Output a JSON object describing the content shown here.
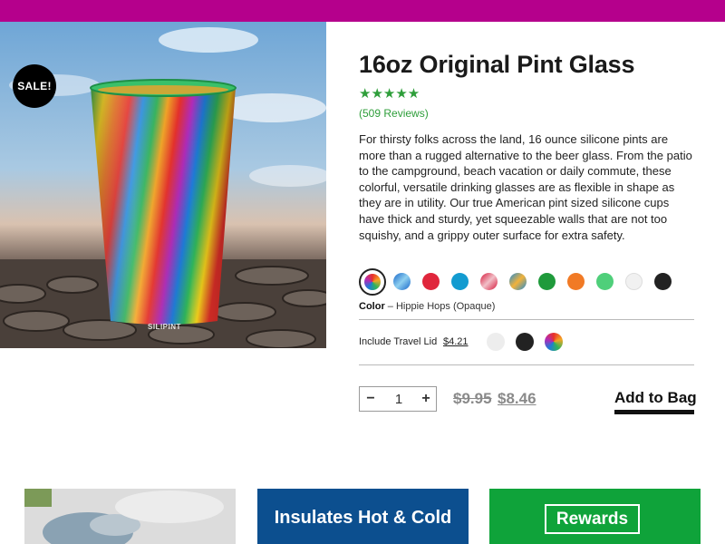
{
  "colors": {
    "top_bar": "#b5008c",
    "star_green": "#2e9e3a",
    "tile_blue": "#0c4f8f",
    "tile_green": "#0fa33a"
  },
  "product": {
    "sale_badge": "SALE!",
    "image_logo": "SILIPINT",
    "title": "16oz Original Pint Glass",
    "stars": "★★★★★",
    "rating": 5,
    "reviews": "(509 Reviews)",
    "description": "For thirsty folks across the land, 16 ounce silicone pints are more than a rugged alternative to the beer glass. From the patio to the campground, beach vacation or daily commute, these colorful, versatile drinking glasses are as flexible in shape as they are in utility. Our true American pint sized silicone cups have thick and sturdy, yet squeezable walls that are not too squishy, and a grippy outer surface for extra safety."
  },
  "swatches": [
    {
      "name": "hippie-hops",
      "color": "conic-gradient(#e8302a, #f5a623, #2fb45a, #1e7bd8, #b02bb8, #e8302a)",
      "selected": true
    },
    {
      "name": "blue-swirl",
      "color": "linear-gradient(135deg, #1766c9 0%, #8fd0f0 50%, #1766c9 100%)"
    },
    {
      "name": "red",
      "color": "#e0263c"
    },
    {
      "name": "aqua",
      "color": "#139bd0"
    },
    {
      "name": "red-white-swirl",
      "color": "linear-gradient(135deg, #d6173a 0%, #f1c0c8 50%, #d6173a 100%)"
    },
    {
      "name": "teal-swirl",
      "color": "linear-gradient(135deg, #1e8bd6 0%, #f2b23a 50%, #1e8bd6 100%)"
    },
    {
      "name": "green",
      "color": "#1f9a3b"
    },
    {
      "name": "orange",
      "color": "#f17a25"
    },
    {
      "name": "mint",
      "color": "#4fcf7a"
    },
    {
      "name": "white",
      "color": "#f1f1f1"
    },
    {
      "name": "black",
      "color": "#222222"
    }
  ],
  "color_selection": {
    "label": "Color",
    "value": "– Hippie Hops (Opaque)"
  },
  "lid": {
    "label": "Include Travel Lid",
    "price": "$4.21",
    "options": [
      {
        "name": "clear",
        "color": "#ededed"
      },
      {
        "name": "black",
        "color": "#222222"
      },
      {
        "name": "hippie-hops",
        "color": "conic-gradient(#e8302a, #f5a623, #2fb45a, #1e7bd8, #b02bb8, #e8302a)"
      }
    ]
  },
  "purchase": {
    "quantity": "1",
    "minus": "−",
    "plus": "+",
    "old_price": "$9.95",
    "new_price": "$8.46",
    "add_to_bag": "Add to Bag"
  },
  "tiles": {
    "insulates": "Insulates Hot & Cold",
    "rewards": "Rewards"
  }
}
